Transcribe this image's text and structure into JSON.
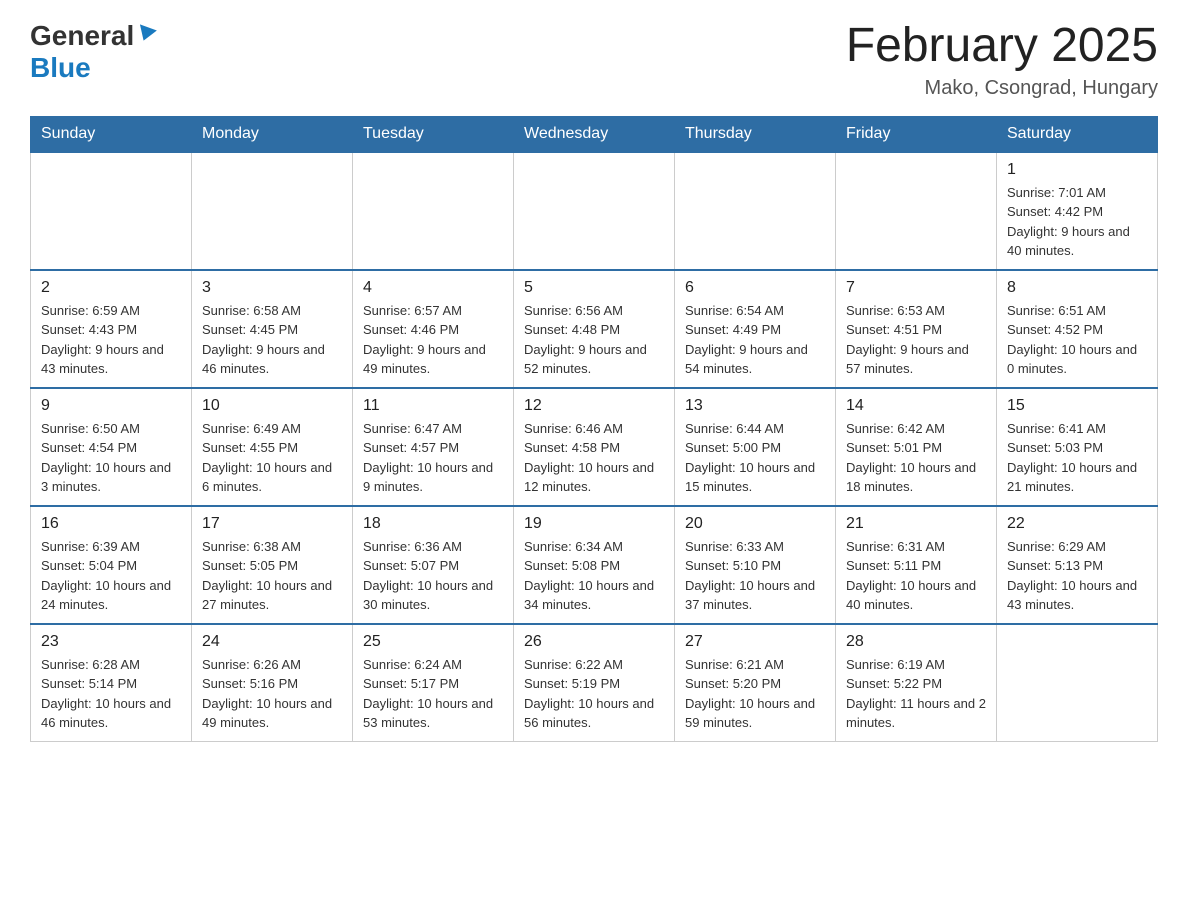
{
  "header": {
    "logo_general": "General",
    "logo_blue": "Blue",
    "month_title": "February 2025",
    "location": "Mako, Csongrad, Hungary"
  },
  "days_of_week": [
    "Sunday",
    "Monday",
    "Tuesday",
    "Wednesday",
    "Thursday",
    "Friday",
    "Saturday"
  ],
  "weeks": [
    [
      {
        "day": "",
        "sunrise": "",
        "sunset": "",
        "daylight": ""
      },
      {
        "day": "",
        "sunrise": "",
        "sunset": "",
        "daylight": ""
      },
      {
        "day": "",
        "sunrise": "",
        "sunset": "",
        "daylight": ""
      },
      {
        "day": "",
        "sunrise": "",
        "sunset": "",
        "daylight": ""
      },
      {
        "day": "",
        "sunrise": "",
        "sunset": "",
        "daylight": ""
      },
      {
        "day": "",
        "sunrise": "",
        "sunset": "",
        "daylight": ""
      },
      {
        "day": "1",
        "sunrise": "Sunrise: 7:01 AM",
        "sunset": "Sunset: 4:42 PM",
        "daylight": "Daylight: 9 hours and 40 minutes."
      }
    ],
    [
      {
        "day": "2",
        "sunrise": "Sunrise: 6:59 AM",
        "sunset": "Sunset: 4:43 PM",
        "daylight": "Daylight: 9 hours and 43 minutes."
      },
      {
        "day": "3",
        "sunrise": "Sunrise: 6:58 AM",
        "sunset": "Sunset: 4:45 PM",
        "daylight": "Daylight: 9 hours and 46 minutes."
      },
      {
        "day": "4",
        "sunrise": "Sunrise: 6:57 AM",
        "sunset": "Sunset: 4:46 PM",
        "daylight": "Daylight: 9 hours and 49 minutes."
      },
      {
        "day": "5",
        "sunrise": "Sunrise: 6:56 AM",
        "sunset": "Sunset: 4:48 PM",
        "daylight": "Daylight: 9 hours and 52 minutes."
      },
      {
        "day": "6",
        "sunrise": "Sunrise: 6:54 AM",
        "sunset": "Sunset: 4:49 PM",
        "daylight": "Daylight: 9 hours and 54 minutes."
      },
      {
        "day": "7",
        "sunrise": "Sunrise: 6:53 AM",
        "sunset": "Sunset: 4:51 PM",
        "daylight": "Daylight: 9 hours and 57 minutes."
      },
      {
        "day": "8",
        "sunrise": "Sunrise: 6:51 AM",
        "sunset": "Sunset: 4:52 PM",
        "daylight": "Daylight: 10 hours and 0 minutes."
      }
    ],
    [
      {
        "day": "9",
        "sunrise": "Sunrise: 6:50 AM",
        "sunset": "Sunset: 4:54 PM",
        "daylight": "Daylight: 10 hours and 3 minutes."
      },
      {
        "day": "10",
        "sunrise": "Sunrise: 6:49 AM",
        "sunset": "Sunset: 4:55 PM",
        "daylight": "Daylight: 10 hours and 6 minutes."
      },
      {
        "day": "11",
        "sunrise": "Sunrise: 6:47 AM",
        "sunset": "Sunset: 4:57 PM",
        "daylight": "Daylight: 10 hours and 9 minutes."
      },
      {
        "day": "12",
        "sunrise": "Sunrise: 6:46 AM",
        "sunset": "Sunset: 4:58 PM",
        "daylight": "Daylight: 10 hours and 12 minutes."
      },
      {
        "day": "13",
        "sunrise": "Sunrise: 6:44 AM",
        "sunset": "Sunset: 5:00 PM",
        "daylight": "Daylight: 10 hours and 15 minutes."
      },
      {
        "day": "14",
        "sunrise": "Sunrise: 6:42 AM",
        "sunset": "Sunset: 5:01 PM",
        "daylight": "Daylight: 10 hours and 18 minutes."
      },
      {
        "day": "15",
        "sunrise": "Sunrise: 6:41 AM",
        "sunset": "Sunset: 5:03 PM",
        "daylight": "Daylight: 10 hours and 21 minutes."
      }
    ],
    [
      {
        "day": "16",
        "sunrise": "Sunrise: 6:39 AM",
        "sunset": "Sunset: 5:04 PM",
        "daylight": "Daylight: 10 hours and 24 minutes."
      },
      {
        "day": "17",
        "sunrise": "Sunrise: 6:38 AM",
        "sunset": "Sunset: 5:05 PM",
        "daylight": "Daylight: 10 hours and 27 minutes."
      },
      {
        "day": "18",
        "sunrise": "Sunrise: 6:36 AM",
        "sunset": "Sunset: 5:07 PM",
        "daylight": "Daylight: 10 hours and 30 minutes."
      },
      {
        "day": "19",
        "sunrise": "Sunrise: 6:34 AM",
        "sunset": "Sunset: 5:08 PM",
        "daylight": "Daylight: 10 hours and 34 minutes."
      },
      {
        "day": "20",
        "sunrise": "Sunrise: 6:33 AM",
        "sunset": "Sunset: 5:10 PM",
        "daylight": "Daylight: 10 hours and 37 minutes."
      },
      {
        "day": "21",
        "sunrise": "Sunrise: 6:31 AM",
        "sunset": "Sunset: 5:11 PM",
        "daylight": "Daylight: 10 hours and 40 minutes."
      },
      {
        "day": "22",
        "sunrise": "Sunrise: 6:29 AM",
        "sunset": "Sunset: 5:13 PM",
        "daylight": "Daylight: 10 hours and 43 minutes."
      }
    ],
    [
      {
        "day": "23",
        "sunrise": "Sunrise: 6:28 AM",
        "sunset": "Sunset: 5:14 PM",
        "daylight": "Daylight: 10 hours and 46 minutes."
      },
      {
        "day": "24",
        "sunrise": "Sunrise: 6:26 AM",
        "sunset": "Sunset: 5:16 PM",
        "daylight": "Daylight: 10 hours and 49 minutes."
      },
      {
        "day": "25",
        "sunrise": "Sunrise: 6:24 AM",
        "sunset": "Sunset: 5:17 PM",
        "daylight": "Daylight: 10 hours and 53 minutes."
      },
      {
        "day": "26",
        "sunrise": "Sunrise: 6:22 AM",
        "sunset": "Sunset: 5:19 PM",
        "daylight": "Daylight: 10 hours and 56 minutes."
      },
      {
        "day": "27",
        "sunrise": "Sunrise: 6:21 AM",
        "sunset": "Sunset: 5:20 PM",
        "daylight": "Daylight: 10 hours and 59 minutes."
      },
      {
        "day": "28",
        "sunrise": "Sunrise: 6:19 AM",
        "sunset": "Sunset: 5:22 PM",
        "daylight": "Daylight: 11 hours and 2 minutes."
      },
      {
        "day": "",
        "sunrise": "",
        "sunset": "",
        "daylight": ""
      }
    ]
  ]
}
